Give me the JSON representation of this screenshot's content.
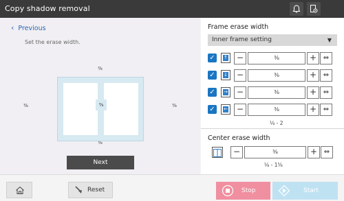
{
  "header": {
    "title": "Copy shadow removal",
    "icons": [
      "bell-icon",
      "document-settings-icon"
    ]
  },
  "left": {
    "back_label": "Previous",
    "instruction": "Set the erase width.",
    "preview": {
      "top": "⅜",
      "left": "⅜",
      "center": "⅜",
      "right": "⅜",
      "bottom": "⅜"
    },
    "next_label": "Next"
  },
  "frame_erase": {
    "title": "Frame erase width",
    "dropdown_value": "Inner frame setting",
    "rows": [
      {
        "side": "top",
        "checked": true,
        "value": "⅜"
      },
      {
        "side": "bottom",
        "checked": true,
        "value": "⅜"
      },
      {
        "side": "right",
        "checked": true,
        "value": "⅜"
      },
      {
        "side": "left",
        "checked": true,
        "value": "⅜"
      }
    ],
    "range": "⅛ - 2",
    "minus": "−",
    "plus": "+",
    "swap": "⇔"
  },
  "center_erase": {
    "title": "Center erase width",
    "value": "⅜",
    "range": "⅛ - 1⅝"
  },
  "footer": {
    "reset_label": "Reset",
    "stop_label": "Stop",
    "start_label": "Start"
  },
  "colors": {
    "titlebar": "#3a3a3a",
    "accent": "#1a76c2",
    "stop": "#f08fa0",
    "start": "#bfe2f2"
  }
}
